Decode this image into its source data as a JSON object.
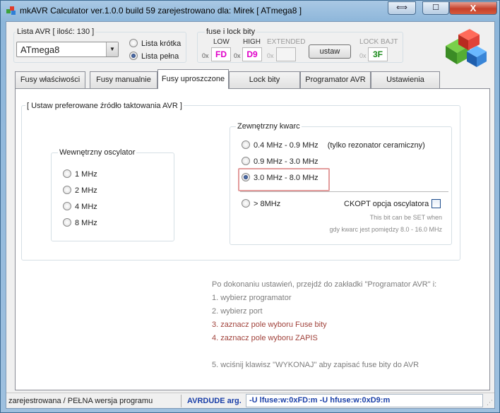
{
  "window": {
    "title": "mkAVR Calculator ver.1.0.0 build 59  zarejestrowano dla: Mirek    [ ATmega8 ]",
    "close_glyph": "X",
    "resize_glyph": "⟺",
    "maximize_glyph": "☐"
  },
  "avr_list": {
    "group_title": "Lista AVR [ ilość: 130 ]",
    "selected": "ATmega8",
    "radio_short": "Lista krótka",
    "radio_full": "Lista pełna",
    "selected_list": "full"
  },
  "fuses": {
    "group_title": "fuse i lock bity",
    "low_label": "LOW",
    "high_label": "HIGH",
    "extended_label": "EXTENDED",
    "lock_label": "LOCK BAJT",
    "prefix": "0x",
    "low_value": "FD",
    "high_value": "D9",
    "extended_value": "",
    "lock_value": "3F",
    "set_button": "ustaw",
    "low_color": "#e000c8",
    "high_color": "#e000c8",
    "lock_color": "#1a8a1a"
  },
  "tabs": [
    {
      "label": "Fusy właściwości",
      "active": false
    },
    {
      "label": "Fusy manualnie",
      "active": false
    },
    {
      "label": "Fusy uproszczone",
      "active": true
    },
    {
      "label": "Lock bity",
      "active": false
    },
    {
      "label": "Programator AVR",
      "active": false
    },
    {
      "label": "Ustawienia",
      "active": false
    }
  ],
  "clock": {
    "group_title": "[ Ustaw preferowane źródło taktowania AVR ]",
    "internal": {
      "title": "Wewnętrzny oscylator",
      "options": [
        "1 MHz",
        "2 MHz",
        "4 MHz",
        "8 MHz"
      ]
    },
    "external": {
      "title": "Zewnętrzny kwarc",
      "options": [
        {
          "label": "0.4 MHz - 0.9 MHz",
          "note": "(tylko rezonator ceramiczny)",
          "checked": false
        },
        {
          "label": "0.9 MHz - 3.0 MHz",
          "note": "",
          "checked": false
        },
        {
          "label": "3.0 MHz - 8.0 MHz",
          "note": "",
          "checked": true
        },
        {
          "label": "> 8MHz",
          "note": "",
          "checked": false
        }
      ],
      "ckopt_label": "CKOPT opcja oscylatora",
      "hint_line1": "This bit can be SET when",
      "hint_line2": "gdy kwarc jest pomiędzy 8.0 - 16.0 MHz"
    }
  },
  "instructions": {
    "intro": "Po dokonaniu ustawień, przejdź do zakładki \"Programator AVR\" i:",
    "steps": [
      "1. wybierz programator",
      "2. wybierz port",
      "3. zaznacz pole wyboru Fuse bity",
      "4. zaznacz pole wyboru ZAPIS",
      "5. wciśnij klawisz \"WYKONAJ\" aby zapisać fuse bity do AVR"
    ]
  },
  "status": {
    "left_text": "zarejestrowana / PEŁNA wersja programu",
    "avrdude_label": "AVRDUDE arg.",
    "avrdude_value": "-U lfuse:w:0xFD:m  -U hfuse:w:0xD9:m"
  }
}
